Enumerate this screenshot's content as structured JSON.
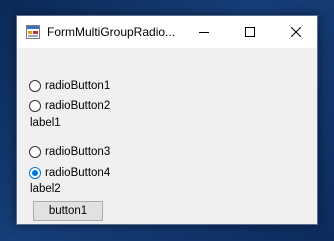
{
  "window": {
    "title": "FormMultiGroupRadio...",
    "icon": "winforms-app-icon",
    "controls": {
      "minimize": "minimize-icon",
      "maximize": "maximize-icon",
      "close": "close-icon"
    }
  },
  "group1": {
    "radios": [
      {
        "label": "radioButton1",
        "checked": false
      },
      {
        "label": "radioButton2",
        "checked": false
      }
    ],
    "label": "label1"
  },
  "group2": {
    "radios": [
      {
        "label": "radioButton3",
        "checked": false
      },
      {
        "label": "radioButton4",
        "checked": true
      }
    ],
    "label": "label2"
  },
  "button": {
    "label": "button1"
  },
  "colors": {
    "accent": "#0078d7",
    "window_bg": "#f0f0f0",
    "titlebar_bg": "#ffffff",
    "button_bg": "#e1e1e1"
  }
}
